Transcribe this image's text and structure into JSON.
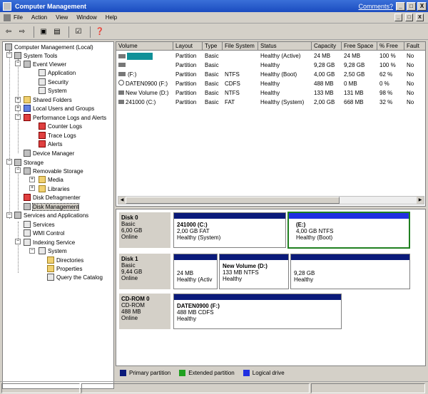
{
  "window": {
    "title": "Computer Management",
    "comments_link": "Comments?",
    "buttons": [
      "_",
      "□",
      "X"
    ]
  },
  "menu": {
    "items": [
      "File",
      "Action",
      "View",
      "Window",
      "Help"
    ],
    "child_buttons": [
      "_",
      "□",
      "X"
    ]
  },
  "toolbar": {
    "icons": [
      "back-icon",
      "forward-icon",
      "up-icon",
      "show-tree-icon",
      "properties-icon",
      "help-icon"
    ]
  },
  "tree": {
    "root": "Computer Management (Local)",
    "system_tools": "System Tools",
    "event_viewer": "Event Viewer",
    "application": "Application",
    "security": "Security",
    "system": "System",
    "shared_folders": "Shared Folders",
    "local_users": "Local Users and Groups",
    "perf_logs": "Performance Logs and Alerts",
    "counter_logs": "Counter Logs",
    "trace_logs": "Trace Logs",
    "alerts": "Alerts",
    "device_manager": "Device Manager",
    "storage": "Storage",
    "removable_storage": "Removable Storage",
    "media": "Media",
    "libraries": "Libraries",
    "disk_defrag": "Disk Defragmenter",
    "disk_management": "Disk Management",
    "services_apps": "Services and Applications",
    "services": "Services",
    "wmi": "WMI Control",
    "indexing": "Indexing Service",
    "idx_system": "System",
    "directories": "Directories",
    "properties": "Properties",
    "query": "Query the Catalog"
  },
  "volumes": {
    "columns": [
      "Volume",
      "Layout",
      "Type",
      "File System",
      "Status",
      "Capacity",
      "Free Space",
      "% Free",
      "Fault"
    ],
    "rows": [
      [
        "",
        "Partition",
        "Basic",
        "",
        "Healthy (Active)",
        "24 MB",
        "24 MB",
        "100 %",
        "No"
      ],
      [
        "",
        "Partition",
        "Basic",
        "",
        "Healthy",
        "9,28 GB",
        "9,28 GB",
        "100 %",
        "No"
      ],
      [
        "(F:)",
        "Partition",
        "Basic",
        "NTFS",
        "Healthy (Boot)",
        "4,00 GB",
        "2,50 GB",
        "62 %",
        "No"
      ],
      [
        "DATEN0900 (F:)",
        "Partition",
        "Basic",
        "CDFS",
        "Healthy",
        "488 MB",
        "0 MB",
        "0 %",
        "No"
      ],
      [
        "New Volume (D:)",
        "Partition",
        "Basic",
        "NTFS",
        "Healthy",
        "133 MB",
        "131 MB",
        "98 %",
        "No"
      ],
      [
        "241000 (C:)",
        "Partition",
        "Basic",
        "FAT",
        "Healthy (System)",
        "2,00 GB",
        "668 MB",
        "32 %",
        "No"
      ]
    ]
  },
  "disks": [
    {
      "name": "Disk 0",
      "type": "Basic",
      "size": "6,00 GB",
      "status": "Online",
      "parts": [
        {
          "title": "241000  (C:)",
          "line1": "2,00 GB FAT",
          "line2": "Healthy (System)"
        },
        {
          "title": "(E:)",
          "line1": "4,00 GB NTFS",
          "line2": "Healthy (Boot)"
        }
      ]
    },
    {
      "name": "Disk 1",
      "type": "Basic",
      "size": "9,44 GB",
      "status": "Online",
      "parts": [
        {
          "title": "",
          "line1": "24 MB",
          "line2": "Healthy (Activ"
        },
        {
          "title": "New Volume  (D:)",
          "line1": "133 MB NTFS",
          "line2": "Healthy"
        },
        {
          "title": "",
          "line1": "9,28 GB",
          "line2": "Healthy"
        }
      ]
    },
    {
      "name": "CD-ROM 0",
      "type": "CD-ROM",
      "size": "488 MB",
      "status": "Online",
      "parts": [
        {
          "title": "DATEN0900  (F:)",
          "line1": "488 MB CDFS",
          "line2": "Healthy"
        }
      ]
    }
  ],
  "legend": [
    {
      "label": "Primary partition",
      "color": "#0a1a7a"
    },
    {
      "label": "Extended partition",
      "color": "#20a020"
    },
    {
      "label": "Logical drive",
      "color": "#2030e0"
    }
  ]
}
